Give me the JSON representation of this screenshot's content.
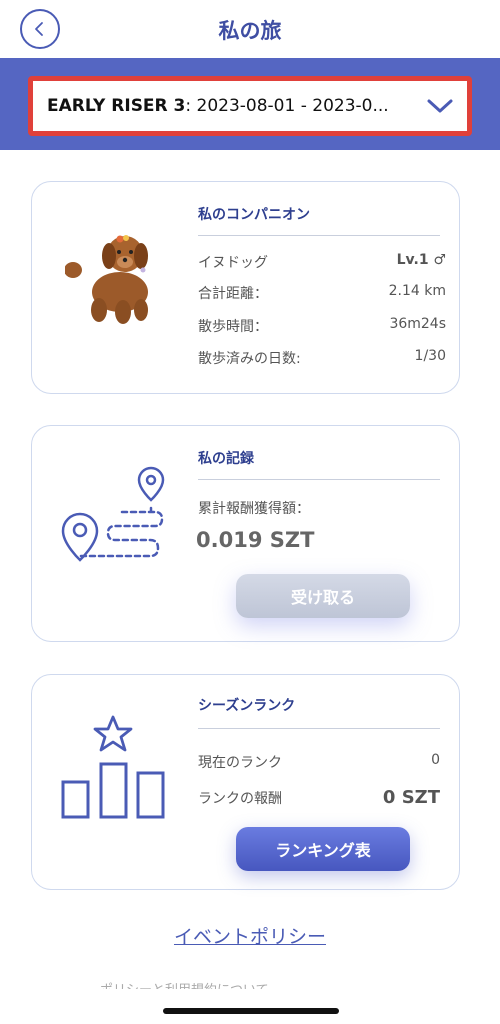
{
  "header": {
    "title": "私の旅"
  },
  "event_selector": {
    "event_name": "EARLY RISER 3",
    "date_range": ": 2023-08-01 - 2023-0..."
  },
  "companion": {
    "title": "私のコンパニオン",
    "breed_label": "イヌドッグ",
    "level": "Lv.1 ♂",
    "distance_label": "合計距離：",
    "distance_value": "2.14 km",
    "walk_time_label": "散歩時間：",
    "walk_time_value": "36m24s",
    "days_label": "散歩済みの日数:",
    "days_value": "1/30"
  },
  "record": {
    "title": "私の記録",
    "reward_label": "累計報酬獲得額：",
    "reward_value": "0.019 SZT",
    "claim_button": "受け取る"
  },
  "season_rank": {
    "title": "シーズンランク",
    "current_rank_label": "現在のランク",
    "current_rank_value": "0",
    "rank_reward_label": "ランクの報酬",
    "rank_reward_value": "0 SZT",
    "ranking_button": "ランキング表"
  },
  "footer": {
    "policy_link": "イベントポリシー",
    "bottom_text": "ポリシーと利用規約について"
  },
  "colors": {
    "accent": "#4a5bb5",
    "header_band": "#5566c2",
    "highlight_border": "#e0403a",
    "card_border": "#cfd9ee"
  }
}
